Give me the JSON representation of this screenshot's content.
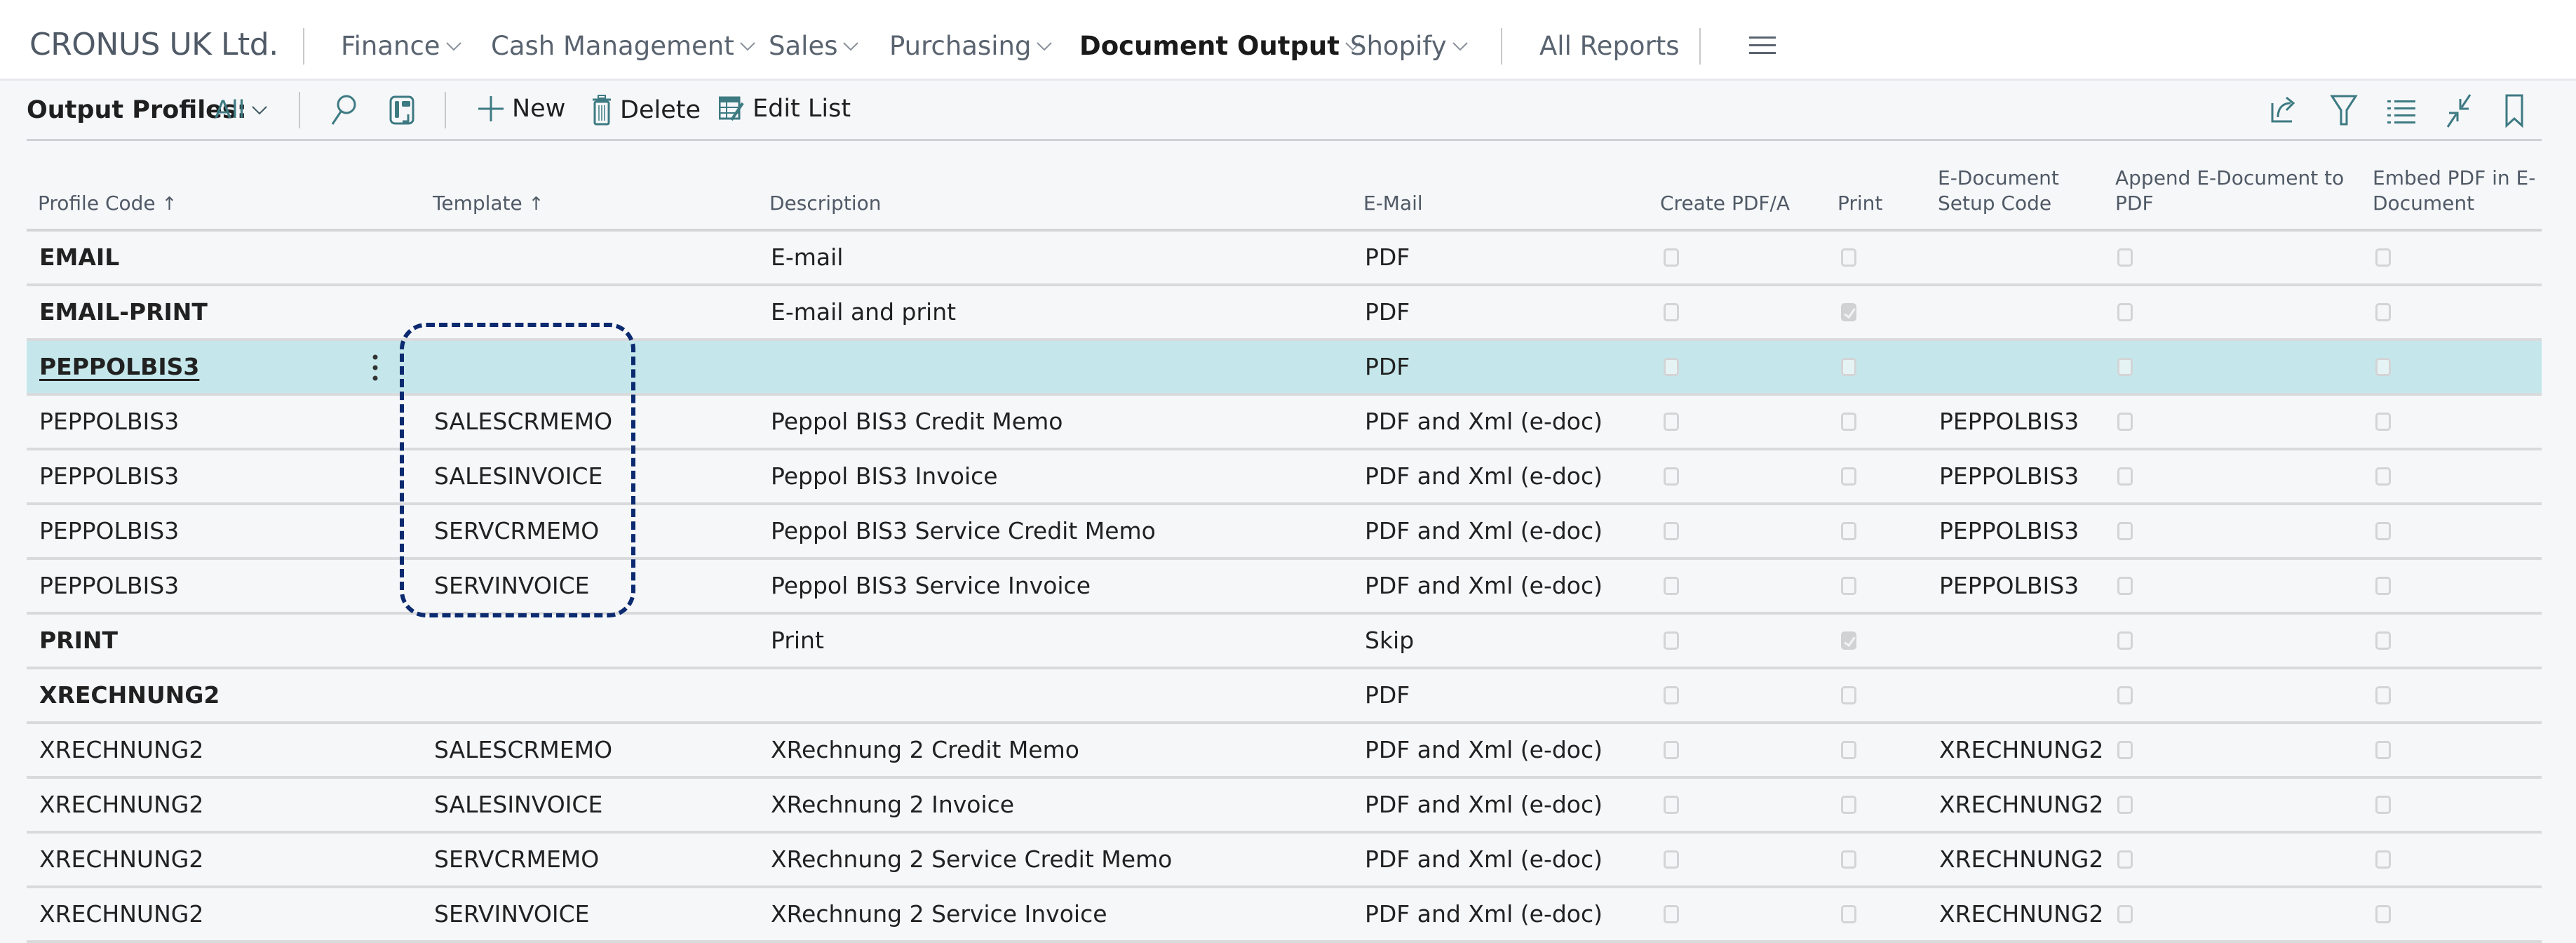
{
  "header": {
    "company": "CRONUS UK Ltd.",
    "nav": [
      {
        "label": "Finance",
        "active": false
      },
      {
        "label": "Cash Management",
        "active": false
      },
      {
        "label": "Sales",
        "active": false
      },
      {
        "label": "Purchasing",
        "active": false
      },
      {
        "label": "Document Output",
        "active": true
      },
      {
        "label": "Shopify",
        "active": false
      }
    ],
    "all_reports": "All Reports",
    "menu_icon": "hamburger-icon"
  },
  "toolbar": {
    "page_label": "Output Profiles:",
    "filter_value": "All",
    "search_icon": "search-icon",
    "layout_icon": "toggle-layout-icon",
    "new_label": "New",
    "delete_label": "Delete",
    "edit_list_label": "Edit List",
    "right_icons": [
      "share-icon",
      "filter-icon",
      "list-view-icon",
      "collapse-icon",
      "bookmark-icon"
    ]
  },
  "accent_color": "#3d7a82",
  "selected_row_color": "#c5e7eb",
  "table": {
    "columns": [
      {
        "key": "profile_code",
        "label": "Profile Code",
        "sorted": "asc"
      },
      {
        "key": "template",
        "label": "Template",
        "sorted": "asc"
      },
      {
        "key": "description",
        "label": "Description"
      },
      {
        "key": "email",
        "label": "E-Mail"
      },
      {
        "key": "create_pdfa",
        "label": "Create PDF/A"
      },
      {
        "key": "print",
        "label": "Print"
      },
      {
        "key": "edoc_setup_code",
        "label": "E-Document Setup Code"
      },
      {
        "key": "append_edoc",
        "label": "Append E-Document to PDF"
      },
      {
        "key": "embed_pdf",
        "label": "Embed PDF in E-Document"
      }
    ],
    "sort_arrow": "↑",
    "rows": [
      {
        "profile_code": "EMAIL",
        "template": "",
        "description": "E-mail",
        "email": "PDF",
        "create_pdfa": false,
        "print": false,
        "edoc_setup_code": "",
        "append_edoc": false,
        "embed_pdf": false,
        "bold": true
      },
      {
        "profile_code": "EMAIL-PRINT",
        "template": "",
        "description": "E-mail and print",
        "email": "PDF",
        "create_pdfa": false,
        "print": true,
        "edoc_setup_code": "",
        "append_edoc": false,
        "embed_pdf": false,
        "bold": true
      },
      {
        "profile_code": "PEPPOLBIS3",
        "template": "",
        "description": "",
        "email": "PDF",
        "create_pdfa": false,
        "print": false,
        "edoc_setup_code": "",
        "append_edoc": false,
        "embed_pdf": false,
        "bold": true,
        "selected": true
      },
      {
        "profile_code": "PEPPOLBIS3",
        "template": "SALESCRMEMO",
        "description": "Peppol BIS3 Credit Memo",
        "email": "PDF and Xml (e-doc)",
        "create_pdfa": false,
        "print": false,
        "edoc_setup_code": "PEPPOLBIS3",
        "append_edoc": false,
        "embed_pdf": false,
        "bold": false
      },
      {
        "profile_code": "PEPPOLBIS3",
        "template": "SALESINVOICE",
        "description": "Peppol BIS3 Invoice",
        "email": "PDF and Xml (e-doc)",
        "create_pdfa": false,
        "print": false,
        "edoc_setup_code": "PEPPOLBIS3",
        "append_edoc": false,
        "embed_pdf": false,
        "bold": false
      },
      {
        "profile_code": "PEPPOLBIS3",
        "template": "SERVCRMEMO",
        "description": "Peppol BIS3 Service Credit Memo",
        "email": "PDF and Xml (e-doc)",
        "create_pdfa": false,
        "print": false,
        "edoc_setup_code": "PEPPOLBIS3",
        "append_edoc": false,
        "embed_pdf": false,
        "bold": false
      },
      {
        "profile_code": "PEPPOLBIS3",
        "template": "SERVINVOICE",
        "description": "Peppol BIS3 Service Invoice",
        "email": "PDF and Xml (e-doc)",
        "create_pdfa": false,
        "print": false,
        "edoc_setup_code": "PEPPOLBIS3",
        "append_edoc": false,
        "embed_pdf": false,
        "bold": false
      },
      {
        "profile_code": "PRINT",
        "template": "",
        "description": "Print",
        "email": "Skip",
        "create_pdfa": false,
        "print": true,
        "edoc_setup_code": "",
        "append_edoc": false,
        "embed_pdf": false,
        "bold": true
      },
      {
        "profile_code": "XRECHNUNG2",
        "template": "",
        "description": "",
        "email": "PDF",
        "create_pdfa": false,
        "print": false,
        "edoc_setup_code": "",
        "append_edoc": false,
        "embed_pdf": false,
        "bold": true
      },
      {
        "profile_code": "XRECHNUNG2",
        "template": "SALESCRMEMO",
        "description": "XRechnung 2 Credit Memo",
        "email": "PDF and Xml (e-doc)",
        "create_pdfa": false,
        "print": false,
        "edoc_setup_code": "XRECHNUNG2",
        "append_edoc": false,
        "embed_pdf": false,
        "bold": false
      },
      {
        "profile_code": "XRECHNUNG2",
        "template": "SALESINVOICE",
        "description": "XRechnung 2 Invoice",
        "email": "PDF and Xml (e-doc)",
        "create_pdfa": false,
        "print": false,
        "edoc_setup_code": "XRECHNUNG2",
        "append_edoc": false,
        "embed_pdf": false,
        "bold": false
      },
      {
        "profile_code": "XRECHNUNG2",
        "template": "SERVCRMEMO",
        "description": "XRechnung 2 Service Credit Memo",
        "email": "PDF and Xml (e-doc)",
        "create_pdfa": false,
        "print": false,
        "edoc_setup_code": "XRECHNUNG2",
        "append_edoc": false,
        "embed_pdf": false,
        "bold": false
      },
      {
        "profile_code": "XRECHNUNG2",
        "template": "SERVINVOICE",
        "description": "XRechnung 2 Service Invoice",
        "email": "PDF and Xml (e-doc)",
        "create_pdfa": false,
        "print": false,
        "edoc_setup_code": "XRECHNUNG2",
        "append_edoc": false,
        "embed_pdf": false,
        "bold": false
      }
    ]
  },
  "annotation": {
    "type": "dashed-highlight",
    "target": "template column, PEPPOLBIS3 rows",
    "color": "#0b2a6f"
  }
}
